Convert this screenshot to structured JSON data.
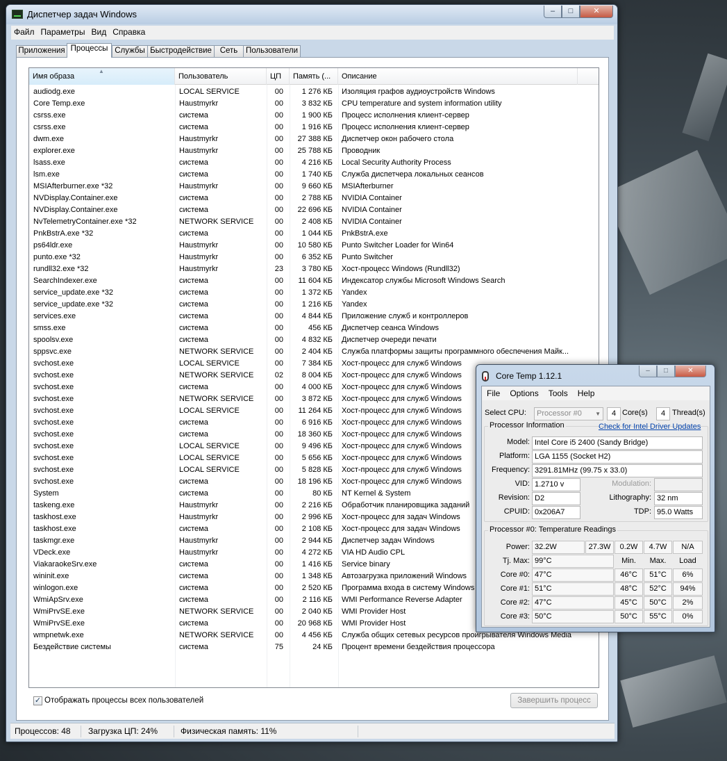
{
  "taskmanager": {
    "title": "Диспетчер задач Windows",
    "menu": [
      "Файл",
      "Параметры",
      "Вид",
      "Справка"
    ],
    "tabs": [
      "Приложения",
      "Процессы",
      "Службы",
      "Быстродействие",
      "Сеть",
      "Пользователи"
    ],
    "active_tab": "Процессы",
    "columns": [
      "Имя образа",
      "Пользователь",
      "ЦП",
      "Память (...",
      "Описание"
    ],
    "processes": [
      [
        "audiodg.exe",
        "LOCAL SERVICE",
        "00",
        "1 276 КБ",
        "Изоляция графов аудиоустройств Windows"
      ],
      [
        "Core Temp.exe",
        "Haustmyrkr",
        "00",
        "3 832 КБ",
        "CPU temperature and system information utility"
      ],
      [
        "csrss.exe",
        "система",
        "00",
        "1 900 КБ",
        "Процесс исполнения клиент-сервер"
      ],
      [
        "csrss.exe",
        "система",
        "00",
        "1 916 КБ",
        "Процесс исполнения клиент-сервер"
      ],
      [
        "dwm.exe",
        "Haustmyrkr",
        "00",
        "27 388 КБ",
        "Диспетчер окон рабочего стола"
      ],
      [
        "explorer.exe",
        "Haustmyrkr",
        "00",
        "25 788 КБ",
        "Проводник"
      ],
      [
        "lsass.exe",
        "система",
        "00",
        "4 216 КБ",
        "Local Security Authority Process"
      ],
      [
        "lsm.exe",
        "система",
        "00",
        "1 740 КБ",
        "Служба диспетчера локальных сеансов"
      ],
      [
        "MSIAfterburner.exe *32",
        "Haustmyrkr",
        "00",
        "9 660 КБ",
        "MSIAfterburner"
      ],
      [
        "NVDisplay.Container.exe",
        "система",
        "00",
        "2 788 КБ",
        "NVIDIA Container"
      ],
      [
        "NVDisplay.Container.exe",
        "система",
        "00",
        "22 696 КБ",
        "NVIDIA Container"
      ],
      [
        "NvTelemetryContainer.exe *32",
        "NETWORK SERVICE",
        "00",
        "2 408 КБ",
        "NVIDIA Container"
      ],
      [
        "PnkBstrA.exe *32",
        "система",
        "00",
        "1 044 КБ",
        "PnkBstrA.exe"
      ],
      [
        "ps64ldr.exe",
        "Haustmyrkr",
        "00",
        "10 580 КБ",
        "Punto Switcher Loader for Win64"
      ],
      [
        "punto.exe *32",
        "Haustmyrkr",
        "00",
        "6 352 КБ",
        "Punto Switcher"
      ],
      [
        "rundll32.exe *32",
        "Haustmyrkr",
        "23",
        "3 780 КБ",
        "Хост-процесс Windows (Rundll32)"
      ],
      [
        "SearchIndexer.exe",
        "система",
        "00",
        "11 604 КБ",
        "Индексатор службы Microsoft Windows Search"
      ],
      [
        "service_update.exe *32",
        "система",
        "00",
        "1 372 КБ",
        "Yandex"
      ],
      [
        "service_update.exe *32",
        "система",
        "00",
        "1 216 КБ",
        "Yandex"
      ],
      [
        "services.exe",
        "система",
        "00",
        "4 844 КБ",
        "Приложение служб и контроллеров"
      ],
      [
        "smss.exe",
        "система",
        "00",
        "456 КБ",
        "Диспетчер сеанса  Windows"
      ],
      [
        "spoolsv.exe",
        "система",
        "00",
        "4 832 КБ",
        "Диспетчер очереди печати"
      ],
      [
        "sppsvc.exe",
        "NETWORK SERVICE",
        "00",
        "2 404 КБ",
        "Служба платформы защиты программного обеспечения Майк..."
      ],
      [
        "svchost.exe",
        "LOCAL SERVICE",
        "00",
        "7 384 КБ",
        "Хост-процесс для служб Windows"
      ],
      [
        "svchost.exe",
        "NETWORK SERVICE",
        "02",
        "8 004 КБ",
        "Хост-процесс для служб Windows"
      ],
      [
        "svchost.exe",
        "система",
        "00",
        "4 000 КБ",
        "Хост-процесс для служб Windows"
      ],
      [
        "svchost.exe",
        "NETWORK SERVICE",
        "00",
        "3 872 КБ",
        "Хост-процесс для служб Windows"
      ],
      [
        "svchost.exe",
        "LOCAL SERVICE",
        "00",
        "11 264 КБ",
        "Хост-процесс для служб Windows"
      ],
      [
        "svchost.exe",
        "система",
        "00",
        "6 916 КБ",
        "Хост-процесс для служб Windows"
      ],
      [
        "svchost.exe",
        "система",
        "00",
        "18 360 КБ",
        "Хост-процесс для служб Windows"
      ],
      [
        "svchost.exe",
        "LOCAL SERVICE",
        "00",
        "9 496 КБ",
        "Хост-процесс для служб Windows"
      ],
      [
        "svchost.exe",
        "LOCAL SERVICE",
        "00",
        "5 656 КБ",
        "Хост-процесс для служб Windows"
      ],
      [
        "svchost.exe",
        "LOCAL SERVICE",
        "00",
        "5 828 КБ",
        "Хост-процесс для служб Windows"
      ],
      [
        "svchost.exe",
        "система",
        "00",
        "18 196 КБ",
        "Хост-процесс для служб Windows"
      ],
      [
        "System",
        "система",
        "00",
        "80 КБ",
        "NT Kernel & System"
      ],
      [
        "taskeng.exe",
        "Haustmyrkr",
        "00",
        "2 216 КБ",
        "Обработчик планировщика заданий"
      ],
      [
        "taskhost.exe",
        "Haustmyrkr",
        "00",
        "2 996 КБ",
        "Хост-процесс для задач Windows"
      ],
      [
        "taskhost.exe",
        "система",
        "00",
        "2 108 КБ",
        "Хост-процесс для задач Windows"
      ],
      [
        "taskmgr.exe",
        "Haustmyrkr",
        "00",
        "2 944 КБ",
        "Диспетчер задач Windows"
      ],
      [
        "VDeck.exe",
        "Haustmyrkr",
        "00",
        "4 272 КБ",
        "VIA HD Audio CPL"
      ],
      [
        "ViakaraokeSrv.exe",
        "система",
        "00",
        "1 416 КБ",
        "Service binary"
      ],
      [
        "wininit.exe",
        "система",
        "00",
        "1 348 КБ",
        "Автозагрузка приложений Windows"
      ],
      [
        "winlogon.exe",
        "система",
        "00",
        "2 520 КБ",
        "Программа входа в систему Windows"
      ],
      [
        "WmiApSrv.exe",
        "система",
        "00",
        "2 116 КБ",
        "WMI Performance Reverse Adapter"
      ],
      [
        "WmiPrvSE.exe",
        "NETWORK SERVICE",
        "00",
        "2 040 КБ",
        "WMI Provider Host"
      ],
      [
        "WmiPrvSE.exe",
        "система",
        "00",
        "20 968 КБ",
        "WMI Provider Host"
      ],
      [
        "wmpnetwk.exe",
        "NETWORK SERVICE",
        "00",
        "4 456 КБ",
        "Служба общих сетевых ресурсов проигрывателя Windows Media"
      ],
      [
        "Бездействие системы",
        "система",
        "75",
        "24 КБ",
        "Процент времени бездействия процессора"
      ]
    ],
    "show_all_label": "Отображать процессы всех пользователей",
    "show_all_checked": "✓",
    "end_process_label": "Завершить процесс",
    "status": {
      "processes": "Процессов: 48",
      "cpu": "Загрузка ЦП: 24%",
      "memory": "Физическая память: 11%"
    }
  },
  "coretemp": {
    "title": "Core Temp 1.12.1",
    "menu": [
      "File",
      "Options",
      "Tools",
      "Help"
    ],
    "select_cpu_label": "Select CPU:",
    "select_cpu_value": "Processor #0",
    "cores_value": "4",
    "cores_label": "Core(s)",
    "threads_value": "4",
    "threads_label": "Thread(s)",
    "proc_info_title": "Processor Information",
    "driver_link": "Check for Intel Driver Updates",
    "model_label": "Model:",
    "model": "Intel Core i5 2400 (Sandy Bridge)",
    "platform_label": "Platform:",
    "platform": "LGA 1155 (Socket H2)",
    "frequency_label": "Frequency:",
    "frequency": "3291.81MHz (99.75 x 33.0)",
    "vid_label": "VID:",
    "vid": "1.2710 v",
    "modulation_label": "Modulation:",
    "modulation": "",
    "revision_label": "Revision:",
    "revision": "D2",
    "lithography_label": "Lithography:",
    "lithography": "32 nm",
    "cpuid_label": "CPUID:",
    "cpuid": "0x206A7",
    "tdp_label": "TDP:",
    "tdp": "95.0 Watts",
    "temps_title": "Processor #0: Temperature Readings",
    "power_label": "Power:",
    "power": [
      "32.2W",
      "27.3W",
      "0.2W",
      "4.7W",
      "N/A"
    ],
    "tjmax_label": "Tj. Max:",
    "tjmax": "99°C",
    "col_min": "Min.",
    "col_max": "Max.",
    "col_load": "Load",
    "cores": [
      [
        "Core #0:",
        "47°C",
        "46°C",
        "51°C",
        "6%"
      ],
      [
        "Core #1:",
        "51°C",
        "48°C",
        "52°C",
        "94%"
      ],
      [
        "Core #2:",
        "47°C",
        "45°C",
        "50°C",
        "2%"
      ],
      [
        "Core #3:",
        "50°C",
        "50°C",
        "55°C",
        "0%"
      ]
    ]
  }
}
